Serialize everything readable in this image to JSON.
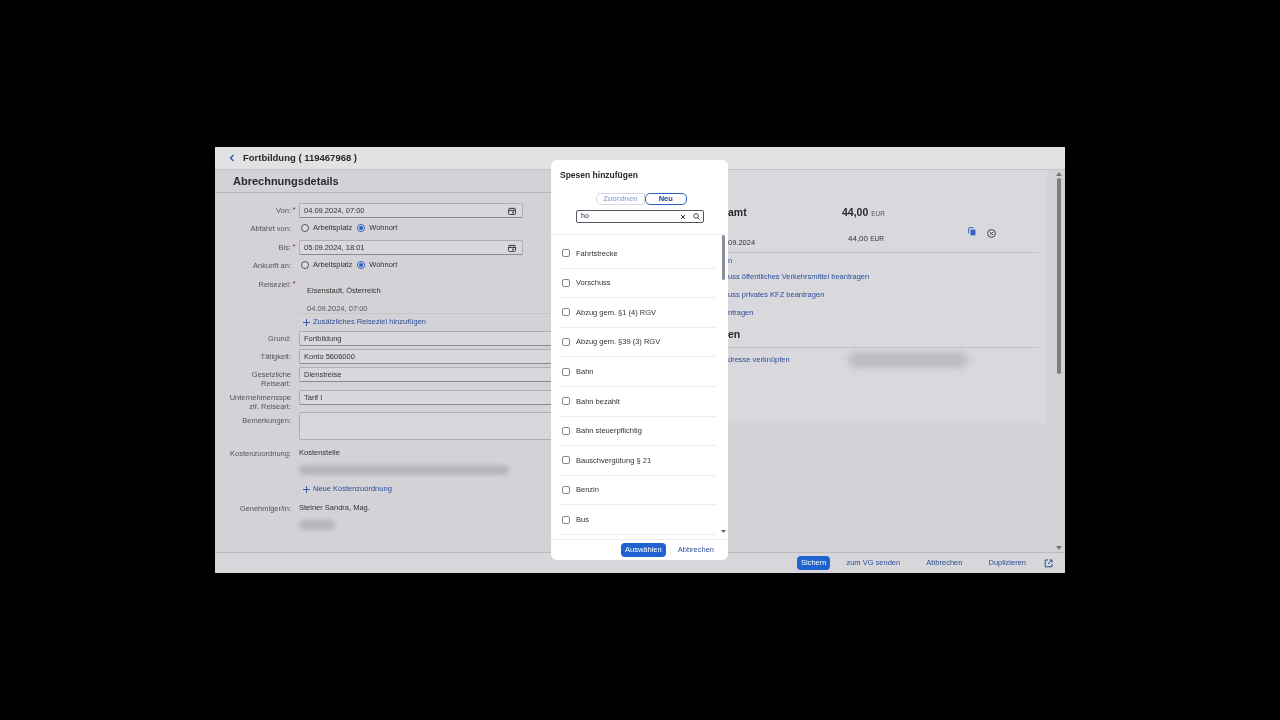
{
  "header": {
    "title": "Fortbildung ( 119467968 )"
  },
  "section": {
    "title": "Abrechnungsdetails"
  },
  "form": [
    {
      "kind": "date",
      "label": "Von:",
      "required_mark": "*",
      "value": "04.09.2024, 07:00"
    },
    {
      "kind": "radio",
      "label": "Abfahrt von:",
      "options": [
        {
          "label": "Arbeitsplatz",
          "selected": false
        },
        {
          "label": "Wohnort",
          "selected": true
        }
      ]
    },
    {
      "kind": "date",
      "label": "Bis:",
      "required_mark": "*",
      "value": "05.09.2024, 18:01"
    },
    {
      "kind": "radio",
      "label": "Ankunft an:",
      "options": [
        {
          "label": "Arbeitsplatz",
          "selected": false
        },
        {
          "label": "Wohnort",
          "selected": true
        }
      ]
    },
    {
      "kind": "destination",
      "label": "Reiseziel:",
      "required_mark": "*",
      "place": "Eisenstadt, Österreich",
      "date": "04.09.2024, 07:00"
    },
    {
      "kind": "link",
      "text": "Zusätzliches Reiseziel hinzufügen"
    },
    {
      "kind": "input",
      "label": "Grund:",
      "value": "Fortbildung"
    },
    {
      "kind": "input",
      "label": "Tätigkeit:",
      "value": "Konto 5606000"
    },
    {
      "kind": "input",
      "label": "Gesetzliche Reiseart:",
      "value": "Dienstreise"
    },
    {
      "kind": "input",
      "label": "Unternehmensspezif. Reiseart:",
      "value": "Tarif I"
    },
    {
      "kind": "textarea",
      "label": "Bemerkungen:"
    },
    {
      "kind": "static",
      "label": "Kostenzuordnung:",
      "value": "Kostenstelle"
    },
    {
      "kind": "link",
      "text": "Neue Kostenzuordnung"
    },
    {
      "kind": "static",
      "label": "Genehmiger/in:",
      "value": "Steiner Sandra, Mag."
    }
  ],
  "summary": {
    "title": "amt",
    "amount": "44,00",
    "currency": "EUR"
  },
  "expense": {
    "amount": "44,00",
    "currency": "EUR",
    "date": "09.2024",
    "partial": "n"
  },
  "links": [
    "uss öffentliches Verkehrsmittel beantragen",
    "uss privates KFZ beantragen",
    "ntragen"
  ],
  "section2": {
    "title": "en",
    "link": "dresse verknüpfen"
  },
  "dialog": {
    "title": "Spesen hinzufügen",
    "segments": [
      {
        "label": "Zuordnen",
        "selected": false
      },
      {
        "label": "Neu",
        "selected": true
      }
    ],
    "search": {
      "value": "ho"
    },
    "items": [
      {
        "label": "Fahrtstrecke",
        "checked": false
      },
      {
        "label": "Vorschuss",
        "checked": false
      },
      {
        "label": "Abzug gem. §1 (4) RGV",
        "checked": false
      },
      {
        "label": "Abzug gem. §39 (3) RGV",
        "checked": false
      },
      {
        "label": "Bahn",
        "checked": false
      },
      {
        "label": "Bahn bezahlt",
        "checked": false
      },
      {
        "label": "Bahn steuerpflichtig",
        "checked": false
      },
      {
        "label": "Bauschvergütung § 21",
        "checked": false
      },
      {
        "label": "Benzin",
        "checked": false
      },
      {
        "label": "Bus",
        "checked": false
      }
    ],
    "buttons": [
      {
        "label": "Auswählen",
        "kind": "primary"
      },
      {
        "label": "Abbrechen",
        "kind": "ghost"
      }
    ]
  },
  "footer": {
    "buttons": [
      {
        "label": "Sichern",
        "kind": "primary"
      },
      {
        "label": "zum VG senden",
        "kind": "ghost"
      },
      {
        "label": "Abbrechen",
        "kind": "ghost"
      },
      {
        "label": "Duplizieren",
        "kind": "ghost"
      }
    ]
  }
}
